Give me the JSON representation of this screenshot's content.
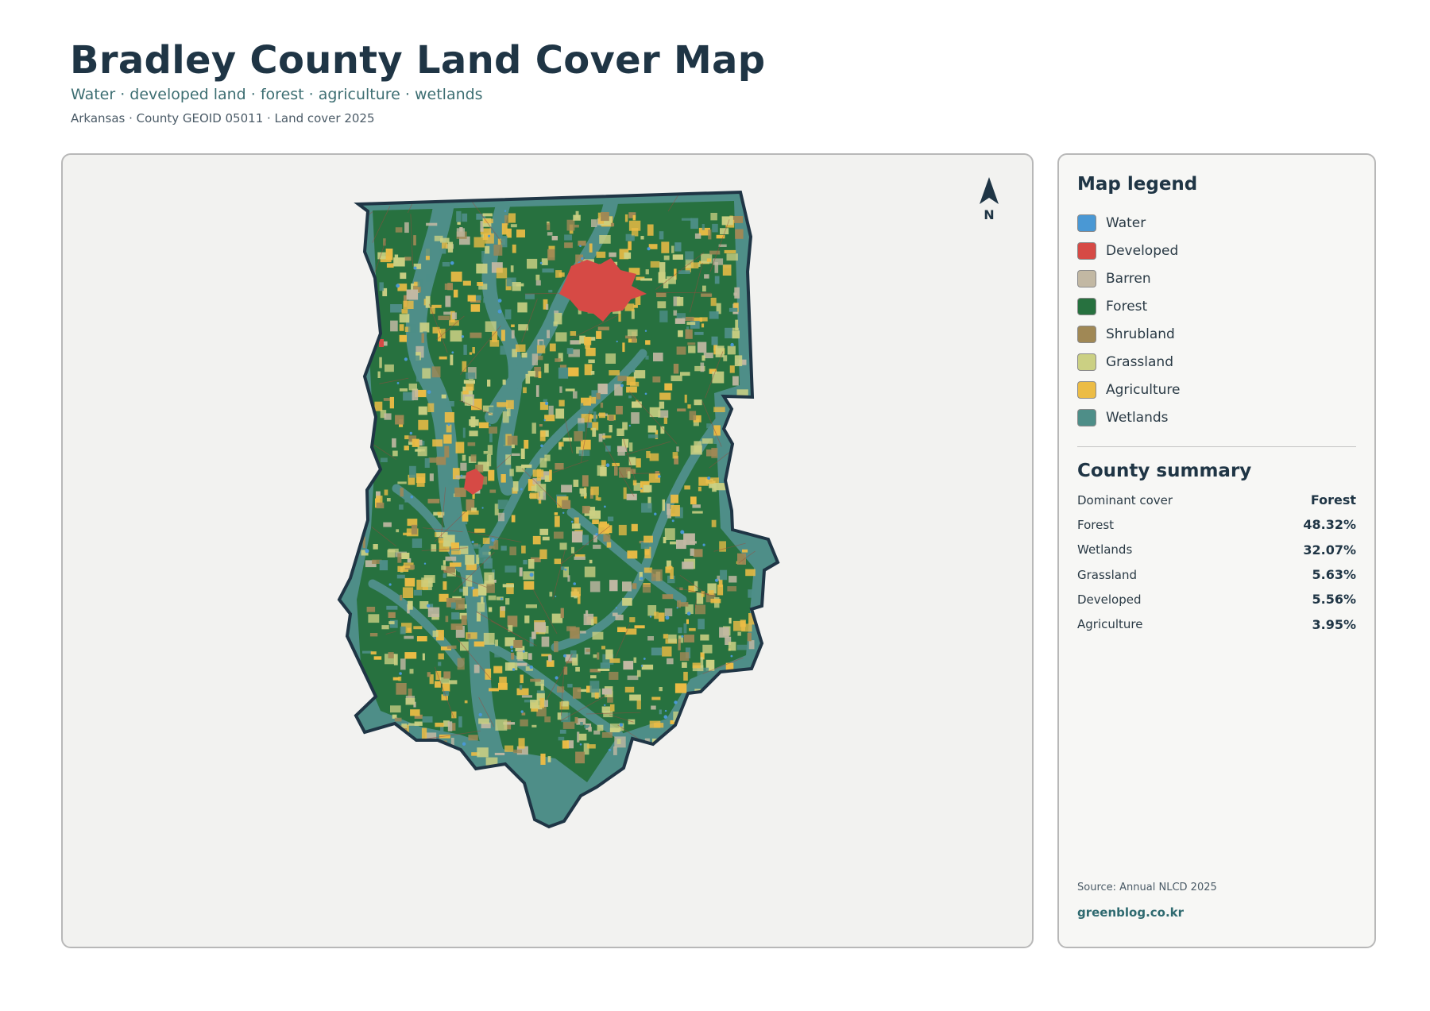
{
  "header": {
    "title": "Bradley County Land Cover Map",
    "subtitle": "Water · developed land · forest · agriculture · wetlands",
    "meta": "Arkansas · County GEOID 05011 · Land cover 2025"
  },
  "map": {
    "north_label": "N"
  },
  "legend": {
    "title": "Map legend",
    "items": [
      {
        "label": "Water",
        "color": "#4a98d4"
      },
      {
        "label": "Developed",
        "color": "#d64a45"
      },
      {
        "label": "Barren",
        "color": "#c2b8a3"
      },
      {
        "label": "Forest",
        "color": "#27713f"
      },
      {
        "label": "Shrubland",
        "color": "#a08855"
      },
      {
        "label": "Grassland",
        "color": "#cbd083"
      },
      {
        "label": "Agriculture",
        "color": "#ecbc45"
      },
      {
        "label": "Wetlands",
        "color": "#4e8e88"
      }
    ]
  },
  "summary": {
    "title": "County summary",
    "rows": [
      {
        "label": "Dominant cover",
        "value": "Forest"
      },
      {
        "label": "Forest",
        "value": "48.32%"
      },
      {
        "label": "Wetlands",
        "value": "32.07%"
      },
      {
        "label": "Grassland",
        "value": "5.63%"
      },
      {
        "label": "Developed",
        "value": "5.56%"
      },
      {
        "label": "Agriculture",
        "value": "3.95%"
      }
    ]
  },
  "footer": {
    "source": "Source: Annual NLCD 2025",
    "site": "greenblog.co.kr"
  }
}
